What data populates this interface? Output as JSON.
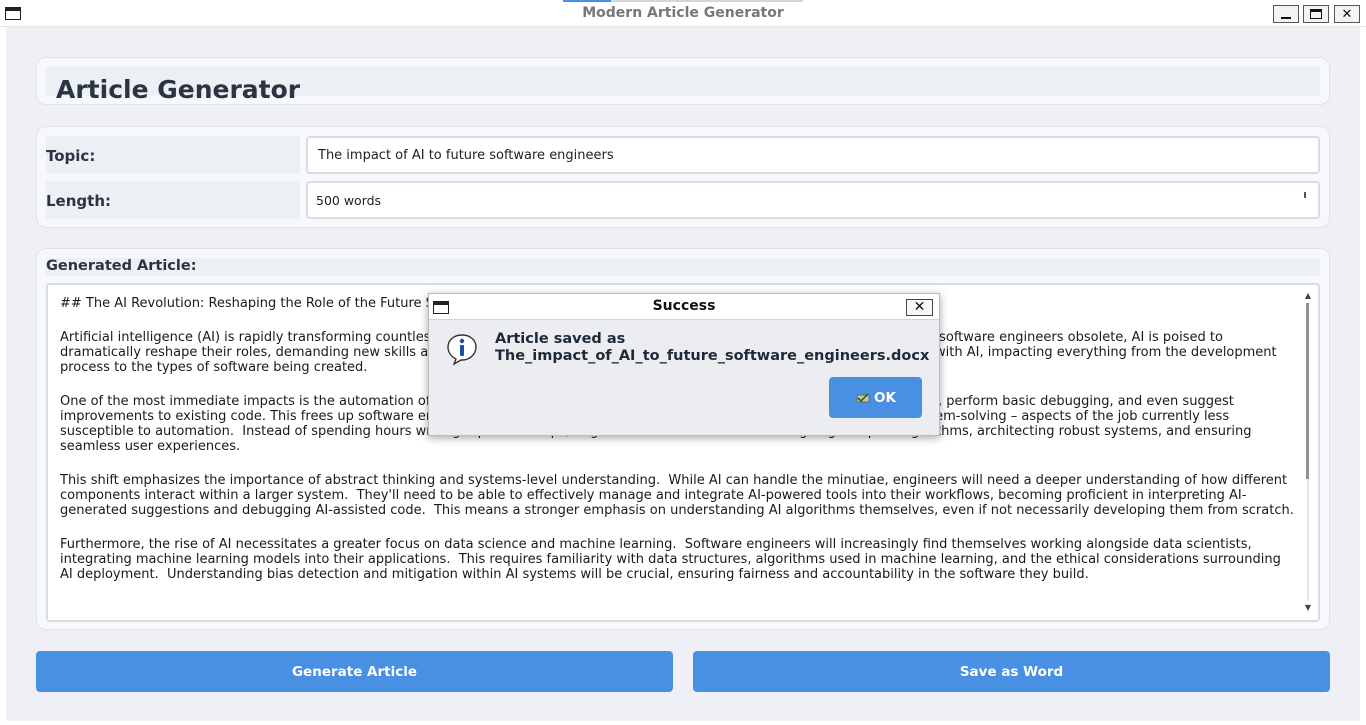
{
  "window": {
    "title": "Modern Article Generator",
    "icons": {
      "app": "window-icon",
      "minimize": "minimize-icon",
      "maximize": "maximize-icon",
      "close": "close-icon"
    }
  },
  "header": {
    "title": "Article Generator"
  },
  "form": {
    "topic_label": "Topic:",
    "topic_value": "The impact of AI to future software engineers",
    "length_label": "Length:",
    "length_value": "500 words"
  },
  "article": {
    "label": "Generated Article:",
    "paragraphs": [
      "## The AI Revolution: Reshaping the Role of the Future Software Engineer",
      "Artificial intelligence (AI) is rapidly transforming countless industries, and software engineering is no exception. Rather than rendering software engineers obsolete, AI is poised to dramatically reshape their roles, demanding new skills and approaches. The future of software engineering will be deeply intertwined with AI, impacting everything from the development process to the types of software being created.",
      "One of the most immediate impacts is the automation of repetitive coding tasks. AI-powered tools can already generate code snippets, perform basic debugging, and even suggest improvements to existing code. This frees up software engineers to focus on higher-level tasks such as design, architecture, and problem-solving – aspects of the job currently less susceptible to automation.  Instead of spending hours writing repetitive loops, engineers can concentrate on designing complex algorithms, architecting robust systems, and ensuring seamless user experiences.",
      "This shift emphasizes the importance of abstract thinking and systems-level understanding.  While AI can handle the minutiae, engineers will need a deeper understanding of how different components interact within a larger system.  They'll need to be able to effectively manage and integrate AI-powered tools into their workflows, becoming proficient in interpreting AI-generated suggestions and debugging AI-assisted code.  This means a stronger emphasis on understanding AI algorithms themselves, even if not necessarily developing them from scratch.",
      "Furthermore, the rise of AI necessitates a greater focus on data science and machine learning.  Software engineers will increasingly find themselves working alongside data scientists, integrating machine learning models into their applications.  This requires familiarity with data structures, algorithms used in machine learning, and the ethical considerations surrounding AI deployment.  Understanding bias detection and mitigation within AI systems will be crucial, ensuring fairness and accountability in the software they build."
    ]
  },
  "buttons": {
    "generate": "Generate Article",
    "save": "Save as Word"
  },
  "dialog": {
    "title": "Success",
    "message_line1": "Article saved as",
    "message_line2": "The_impact_of_AI_to_future_software_engineers.docx",
    "ok_label": "OK",
    "close_glyph": "✕",
    "icons": {
      "info": "info-icon",
      "ok": "ok-icon"
    }
  },
  "colors": {
    "accent": "#4a90e2",
    "background": "#eef0f5",
    "heading": "#2a3443"
  }
}
